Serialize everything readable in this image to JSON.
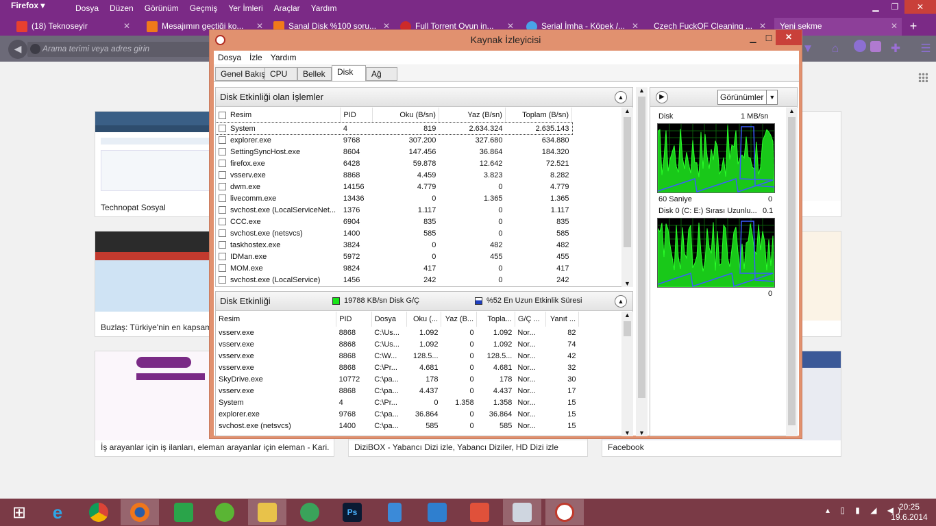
{
  "firefox": {
    "app_button": "Firefox",
    "menu": [
      "Dosya",
      "Düzen",
      "Görünüm",
      "Geçmiş",
      "Yer İmleri",
      "Araçlar",
      "Yardım"
    ],
    "tabs": [
      {
        "title": "(18) Teknoseyir",
        "color": "#e8402f"
      },
      {
        "title": "Mesajımın geçtiği ko...",
        "color": "#f07a1a"
      },
      {
        "title": "Sanal Disk %100 soru...",
        "color": "#f07a1a"
      },
      {
        "title": "Full Torrent Oyun in...",
        "color": "#cc2a2a"
      },
      {
        "title": "Serial İmha - Köpek /...",
        "color": "#49a3e8"
      },
      {
        "title": "Czech FuckOF Cleaning ...",
        "color": ""
      },
      {
        "title": "Yeni sekme",
        "color": ""
      }
    ],
    "url_placeholder": "Arama terimi veya adres girin"
  },
  "newtab": {
    "thumbs": [
      {
        "caption": "Technopat Sosyal"
      },
      {
        "caption": "Buzlaş: Türkiye'nin en kapsamlı"
      },
      {
        "caption": "İş arayanlar için iş ilanları, eleman arayanlar için eleman - Kari..."
      },
      {
        "caption": "DiziBOX - Yabancı Dizi izle, Yabancı Diziler, HD Dizi izle"
      },
      {
        "caption": "Facebook"
      }
    ]
  },
  "resmon": {
    "title": "Kaynak İzleyicisi",
    "menu": [
      "Dosya",
      "İzle",
      "Yardım"
    ],
    "tabs": [
      "Genel Bakış",
      "CPU",
      "Bellek",
      "Disk",
      "Ağ"
    ],
    "proc_panel": {
      "title": "Disk Etkinliği olan İşlemler",
      "columns": [
        "Resim",
        "PID",
        "Oku (B/sn)",
        "Yaz (B/sn)",
        "Toplam (B/sn)"
      ],
      "rows": [
        [
          "System",
          "4",
          "819",
          "2.634.324",
          "2.635.143"
        ],
        [
          "explorer.exe",
          "9768",
          "307.200",
          "327.680",
          "634.880"
        ],
        [
          "SettingSyncHost.exe",
          "8604",
          "147.456",
          "36.864",
          "184.320"
        ],
        [
          "firefox.exe",
          "6428",
          "59.878",
          "12.642",
          "72.521"
        ],
        [
          "vsserv.exe",
          "8868",
          "4.459",
          "3.823",
          "8.282"
        ],
        [
          "dwm.exe",
          "14156",
          "4.779",
          "0",
          "4.779"
        ],
        [
          "livecomm.exe",
          "13436",
          "0",
          "1.365",
          "1.365"
        ],
        [
          "svchost.exe (LocalServiceNet...",
          "1376",
          "1.117",
          "0",
          "1.117"
        ],
        [
          "CCC.exe",
          "6904",
          "835",
          "0",
          "835"
        ],
        [
          "svchost.exe (netsvcs)",
          "1400",
          "585",
          "0",
          "585"
        ],
        [
          "taskhostex.exe",
          "3824",
          "0",
          "482",
          "482"
        ],
        [
          "IDMan.exe",
          "5972",
          "0",
          "455",
          "455"
        ],
        [
          "MOM.exe",
          "9824",
          "417",
          "0",
          "417"
        ],
        [
          "svchost.exe (LocalService)",
          "1456",
          "242",
          "0",
          "242"
        ]
      ]
    },
    "disk_panel": {
      "title": "Disk Etkinliği",
      "io_label": "19788 KB/sn Disk G/Ç",
      "io_color": "#19e619",
      "active_label": "%52 En Uzun Etkinlik Süresi",
      "active_color": "#1f3fbf",
      "columns": [
        "Resim",
        "PID",
        "Dosya",
        "Oku (...",
        "Yaz (B...",
        "Topla...",
        "G/Ç ...",
        "Yanıt ..."
      ],
      "rows": [
        [
          "vsserv.exe",
          "8868",
          "C:\\Us...",
          "1.092",
          "0",
          "1.092",
          "Nor...",
          "82"
        ],
        [
          "vsserv.exe",
          "8868",
          "C:\\Us...",
          "1.092",
          "0",
          "1.092",
          "Nor...",
          "74"
        ],
        [
          "vsserv.exe",
          "8868",
          "C:\\W...",
          "128.5...",
          "0",
          "128.5...",
          "Nor...",
          "42"
        ],
        [
          "vsserv.exe",
          "8868",
          "C:\\Pr...",
          "4.681",
          "0",
          "4.681",
          "Nor...",
          "32"
        ],
        [
          "SkyDrive.exe",
          "10772",
          "C:\\pa...",
          "178",
          "0",
          "178",
          "Nor...",
          "30"
        ],
        [
          "vsserv.exe",
          "8868",
          "C:\\pa...",
          "4.437",
          "0",
          "4.437",
          "Nor...",
          "17"
        ],
        [
          "System",
          "4",
          "C:\\Pr...",
          "0",
          "1.358",
          "1.358",
          "Nor...",
          "15"
        ],
        [
          "explorer.exe",
          "9768",
          "C:\\pa...",
          "36.864",
          "0",
          "36.864",
          "Nor...",
          "15"
        ],
        [
          "svchost.exe (netsvcs)",
          "1400",
          "C:\\pa...",
          "585",
          "0",
          "585",
          "Nor...",
          "15"
        ]
      ]
    },
    "graphs": {
      "views_button": "Görünümler",
      "disk_label": "Disk",
      "disk_max": "1 MB/sn",
      "time_label": "60 Saniye",
      "disk_min": "0",
      "queue_label": "Disk 0 (C: E:) Sırası Uzunlu...",
      "queue_max": "0.1",
      "queue_min": "0"
    }
  },
  "taskbar": {
    "time": "20:25",
    "date": "19.6.2014"
  }
}
